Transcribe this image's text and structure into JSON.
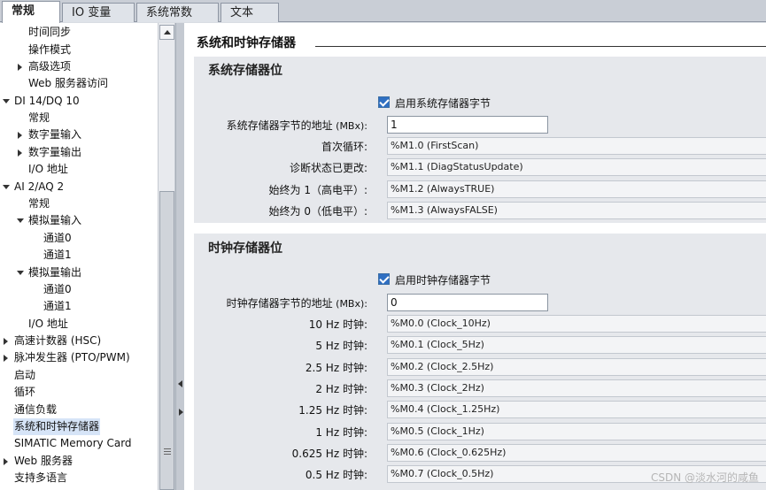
{
  "tabs": [
    "常规",
    "IO 变量",
    "系统常数",
    "文本"
  ],
  "nav": [
    {
      "label": "时间同步",
      "expander": ""
    },
    {
      "label": "操作模式",
      "expander": ""
    },
    {
      "label": "高级选项",
      "expander": "collapsed"
    },
    {
      "label": "Web 服务器访问",
      "expander": ""
    },
    {
      "label": "DI 14/DQ 10",
      "expander": "expanded"
    },
    {
      "label": "常规",
      "expander": ""
    },
    {
      "label": "数字量输入",
      "expander": "collapsed"
    },
    {
      "label": "数字量输出",
      "expander": "collapsed"
    },
    {
      "label": "I/O 地址",
      "expander": ""
    },
    {
      "label": "AI 2/AQ 2",
      "expander": "expanded"
    },
    {
      "label": "常规",
      "expander": ""
    },
    {
      "label": "模拟量输入",
      "expander": "expanded"
    },
    {
      "label": "通道0",
      "expander": ""
    },
    {
      "label": "通道1",
      "expander": ""
    },
    {
      "label": "模拟量输出",
      "expander": "expanded"
    },
    {
      "label": "通道0",
      "expander": ""
    },
    {
      "label": "通道1",
      "expander": ""
    },
    {
      "label": "I/O 地址",
      "expander": ""
    },
    {
      "label": "高速计数器 (HSC)",
      "expander": "collapsed"
    },
    {
      "label": "脉冲发生器 (PTO/PWM)",
      "expander": "collapsed"
    },
    {
      "label": "启动",
      "expander": ""
    },
    {
      "label": "循环",
      "expander": ""
    },
    {
      "label": "通信负载",
      "expander": ""
    },
    {
      "label": "系统和时钟存储器",
      "expander": "",
      "selected": true
    },
    {
      "label": "SIMATIC Memory Card",
      "expander": ""
    },
    {
      "label": "Web 服务器",
      "expander": "collapsed"
    },
    {
      "label": "支持多语言",
      "expander": ""
    }
  ],
  "main": {
    "title": "系统和时钟存储器",
    "system": {
      "title": "系统存储器位",
      "enable_label": "启用系统存储器字节",
      "enabled": true,
      "address_label": "系统存储器字节的地址",
      "address_unit": " (MBx):",
      "address_value": "1",
      "rows": [
        {
          "label": "首次循环:",
          "value": "%M1.0 (FirstScan)"
        },
        {
          "label": "诊断状态已更改:",
          "value": "%M1.1 (DiagStatusUpdate)"
        },
        {
          "label": "始终为 1（高电平）:",
          "value": "%M1.2 (AlwaysTRUE)"
        },
        {
          "label": "始终为 0（低电平）:",
          "value": "%M1.3 (AlwaysFALSE)"
        }
      ]
    },
    "clock": {
      "title": "时钟存储器位",
      "enable_label": "启用时钟存储器字节",
      "enabled": true,
      "address_label": "时钟存储器字节的地址",
      "address_unit": " (MBx):",
      "address_value": "0",
      "rows": [
        {
          "label": "10 Hz 时钟:",
          "value": "%M0.0 (Clock_10Hz)"
        },
        {
          "label": "5 Hz 时钟:",
          "value": "%M0.1 (Clock_5Hz)"
        },
        {
          "label": "2.5 Hz 时钟:",
          "value": "%M0.2 (Clock_2.5Hz)"
        },
        {
          "label": "2 Hz 时钟:",
          "value": "%M0.3 (Clock_2Hz)"
        },
        {
          "label": "1.25 Hz 时钟:",
          "value": "%M0.4 (Clock_1.25Hz)"
        },
        {
          "label": "1 Hz 时钟:",
          "value": "%M0.5 (Clock_1Hz)"
        },
        {
          "label": "0.625 Hz 时钟:",
          "value": "%M0.6 (Clock_0.625Hz)"
        },
        {
          "label": "0.5 Hz 时钟:",
          "value": "%M0.7 (Clock_0.5Hz)"
        }
      ]
    }
  },
  "watermark": "CSDN @淡水河的咸鱼"
}
